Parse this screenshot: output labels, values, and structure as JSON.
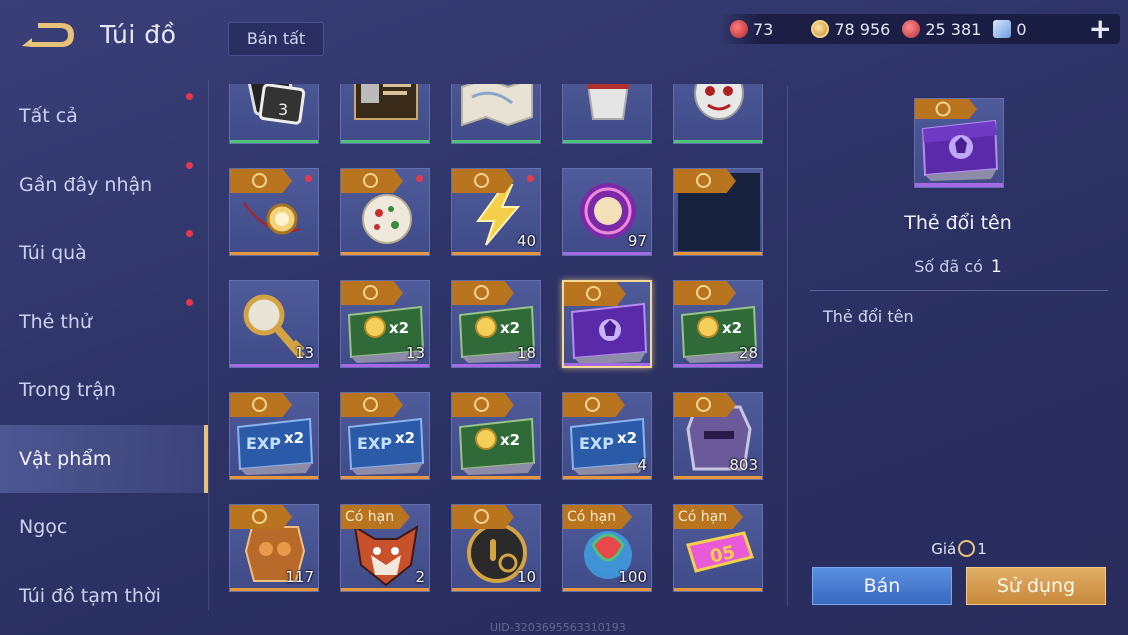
{
  "header": {
    "title": "Túi đồ",
    "sell_all_label": "Bán tất",
    "currencies": [
      {
        "icon": "red-gem-icon",
        "value": "73",
        "color": "#d9484a"
      },
      {
        "icon": "gold-coin-icon",
        "value": "78 956",
        "color": "#e8c47a"
      },
      {
        "icon": "red-ruby-icon",
        "value": "25 381",
        "color": "#d94a50"
      },
      {
        "icon": "blue-voucher-icon",
        "value": "0",
        "color": "#8fb8f0"
      }
    ],
    "plus_label": "+"
  },
  "sidebar": {
    "items": [
      {
        "label": "Tất cả",
        "badge": true,
        "active": false
      },
      {
        "label": "Gần đây nhận",
        "badge": true,
        "active": false
      },
      {
        "label": "Túi quà",
        "badge": true,
        "active": false
      },
      {
        "label": "Thẻ thử",
        "badge": true,
        "active": false
      },
      {
        "label": "Trong trận",
        "badge": false,
        "active": false
      },
      {
        "label": "Vật phẩm",
        "badge": false,
        "active": true
      },
      {
        "label": "Ngọc",
        "badge": false,
        "active": false
      },
      {
        "label": "Túi đồ tạm thời",
        "badge": false,
        "active": false
      }
    ]
  },
  "grid": {
    "rows": [
      [
        {
          "icon": "photo-cards-icon",
          "count": "",
          "tag": "",
          "bar": "green",
          "dot": false
        },
        {
          "icon": "id-card-icon",
          "count": "",
          "tag": "",
          "bar": "green",
          "dot": false
        },
        {
          "icon": "map-icon",
          "count": "",
          "tag": "",
          "bar": "green",
          "dot": false
        },
        {
          "icon": "cup-icon",
          "count": "",
          "tag": "",
          "bar": "green",
          "dot": false
        },
        {
          "icon": "mask-icon",
          "count": "",
          "tag": "",
          "bar": "green",
          "dot": false
        }
      ],
      [
        {
          "icon": "pocket-watch-icon",
          "count": "",
          "tag": "coin",
          "bar": "orange",
          "dot": true
        },
        {
          "icon": "ornament-ball-icon",
          "count": "",
          "tag": "coin",
          "bar": "orange",
          "dot": true
        },
        {
          "icon": "lightning-icon",
          "count": "40",
          "tag": "coin",
          "bar": "orange",
          "dot": true
        },
        {
          "icon": "orb-icon",
          "count": "97",
          "tag": "",
          "bar": "purple",
          "dot": false
        },
        {
          "icon": "dark-card-icon",
          "count": "",
          "tag": "coin",
          "bar": "orange",
          "dot": false
        }
      ],
      [
        {
          "icon": "golden-key-icon",
          "count": "13",
          "tag": "",
          "bar": "purple",
          "dot": false
        },
        {
          "icon": "gold-x2-card-icon",
          "count": "13",
          "tag": "coin",
          "bar": "purple",
          "dot": false
        },
        {
          "icon": "gold-x2-card-icon",
          "count": "18",
          "tag": "coin",
          "bar": "purple",
          "dot": false
        },
        {
          "icon": "rename-card-icon",
          "count": "",
          "tag": "coin",
          "bar": "purple",
          "dot": false,
          "selected": true
        },
        {
          "icon": "gold-x2-card-icon",
          "count": "28",
          "tag": "coin",
          "bar": "purple",
          "dot": false
        }
      ],
      [
        {
          "icon": "exp-x2-card-icon",
          "count": "",
          "tag": "coin",
          "bar": "orange",
          "dot": false
        },
        {
          "icon": "exp-x2-card-icon",
          "count": "",
          "tag": "coin",
          "bar": "orange",
          "dot": false
        },
        {
          "icon": "gold-x2-card-icon",
          "count": "",
          "tag": "coin",
          "bar": "orange",
          "dot": false
        },
        {
          "icon": "exp-x2-card-icon",
          "count": "4",
          "tag": "coin",
          "bar": "orange",
          "dot": false
        },
        {
          "icon": "helmet-icon",
          "count": "803",
          "tag": "coin",
          "bar": "orange",
          "dot": false
        }
      ],
      [
        {
          "icon": "armor-chest-icon",
          "count": "117",
          "tag": "coin",
          "bar": "orange",
          "dot": false
        },
        {
          "icon": "fox-mask-icon",
          "count": "2",
          "tag": "limited",
          "bar": "orange",
          "dot": false
        },
        {
          "icon": "touch-badge-icon",
          "count": "10",
          "tag": "coin",
          "bar": "orange",
          "dot": false
        },
        {
          "icon": "watermelon-icon",
          "count": "100",
          "tag": "limited",
          "bar": "orange",
          "dot": false
        },
        {
          "icon": "ticket-05-icon",
          "count": "",
          "tag": "limited",
          "bar": "orange",
          "dot": false
        }
      ]
    ],
    "limited_label": "Có hạn",
    "x2_label": "x2",
    "exp_label": "EXP",
    "ticket_label": "05"
  },
  "uid": "UID-3203695563310193",
  "detail": {
    "name": "Thẻ đổi tên",
    "owned_label": "Số đã có",
    "owned_value": "1",
    "description": "Thẻ đổi tên",
    "price_label": "Giá",
    "price_value": "1",
    "sell_label": "Bán",
    "use_label": "Sử dụng"
  }
}
